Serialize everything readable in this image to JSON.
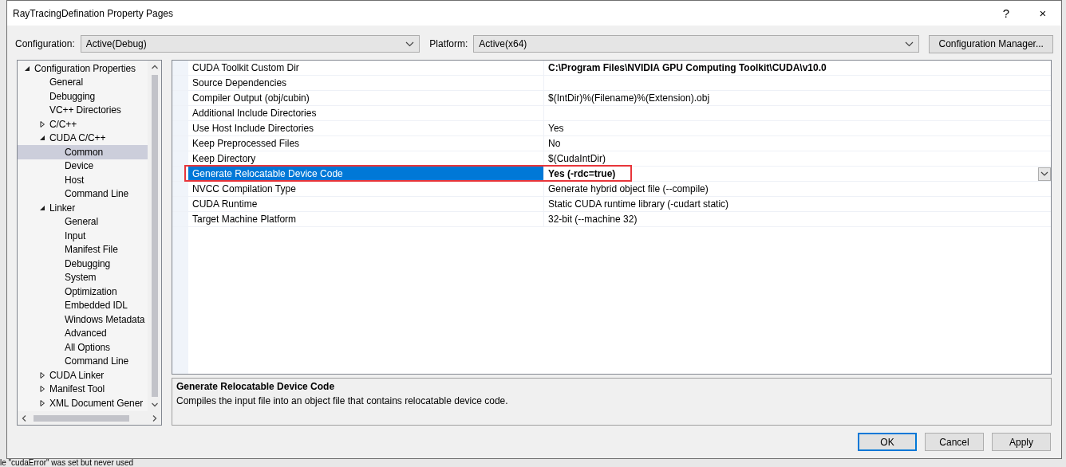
{
  "window": {
    "title": "RayTracingDefination Property Pages",
    "buttons": [
      "?",
      "×"
    ]
  },
  "configuration": {
    "label": "Configuration:",
    "value": "Active(Debug)"
  },
  "platform": {
    "label": "Platform:",
    "value": "Active(x64)"
  },
  "config_manager_button": "Configuration Manager...",
  "sidebar": {
    "items": [
      {
        "label": "Configuration Properties",
        "expanded": true,
        "selected": false,
        "children": [
          {
            "label": "General",
            "selected": false
          },
          {
            "label": "Debugging",
            "selected": false
          },
          {
            "label": "VC++ Directories",
            "selected": false
          },
          {
            "label": "C/C++",
            "expanded": false,
            "selected": false
          },
          {
            "label": "CUDA C/C++",
            "expanded": true,
            "selected": false,
            "children": [
              {
                "label": "Common",
                "selected": true
              },
              {
                "label": "Device",
                "selected": false
              },
              {
                "label": "Host",
                "selected": false
              },
              {
                "label": "Command Line",
                "selected": false
              }
            ]
          },
          {
            "label": "Linker",
            "expanded": true,
            "selected": false,
            "children": [
              {
                "label": "General",
                "selected": false
              },
              {
                "label": "Input",
                "selected": false
              },
              {
                "label": "Manifest File",
                "selected": false
              },
              {
                "label": "Debugging",
                "selected": false
              },
              {
                "label": "System",
                "selected": false
              },
              {
                "label": "Optimization",
                "selected": false
              },
              {
                "label": "Embedded IDL",
                "selected": false
              },
              {
                "label": "Windows Metadata",
                "selected": false
              },
              {
                "label": "Advanced",
                "selected": false
              },
              {
                "label": "All Options",
                "selected": false
              },
              {
                "label": "Command Line",
                "selected": false
              }
            ]
          },
          {
            "label": "CUDA Linker",
            "expanded": false,
            "selected": false
          },
          {
            "label": "Manifest Tool",
            "expanded": false,
            "selected": false
          },
          {
            "label": "XML Document Gener",
            "expanded": false,
            "selected": false
          }
        ]
      }
    ]
  },
  "properties": [
    {
      "name": "CUDA Toolkit Custom Dir",
      "value": "C:\\Program Files\\NVIDIA GPU Computing Toolkit\\CUDA\\v10.0",
      "bold": true,
      "selected": false
    },
    {
      "name": "Source Dependencies",
      "selected": false
    },
    {
      "name": "Compiler Output (obj/cubin)",
      "value": "$(IntDir)%(Filename)%(Extension).obj",
      "bold": false,
      "selected": false
    },
    {
      "name": "Additional Include Directories",
      "selected": false
    },
    {
      "name": "Use Host Include Directories",
      "value": "Yes",
      "bold": false,
      "selected": false
    },
    {
      "name": "Keep Preprocessed Files",
      "value": "No",
      "bold": false,
      "selected": false
    },
    {
      "name": "Keep Directory",
      "value": "$(CudaIntDir)",
      "bold": false,
      "selected": false
    },
    {
      "name": "Generate Relocatable Device Code",
      "value": "Yes (-rdc=true)",
      "bold": true,
      "selected": true
    },
    {
      "name": "NVCC Compilation Type",
      "value": "Generate hybrid object file (--compile)",
      "bold": false,
      "selected": false
    },
    {
      "name": "CUDA Runtime",
      "value": "Static CUDA runtime library (-cudart static)",
      "bold": false,
      "selected": false
    },
    {
      "name": "Target Machine Platform",
      "value": "32-bit (--machine 32)",
      "bold": false,
      "selected": false
    }
  ],
  "description": {
    "title": "Generate Relocatable Device Code",
    "text": "Compiles the input file into an object file that contains relocatable device code."
  },
  "buttons": [
    {
      "label": "OK",
      "default": true
    },
    {
      "label": "Cancel",
      "default": false
    },
    {
      "label": "Apply",
      "default": false
    }
  ],
  "background_text": "le \"cudaError\" was set but never used"
}
